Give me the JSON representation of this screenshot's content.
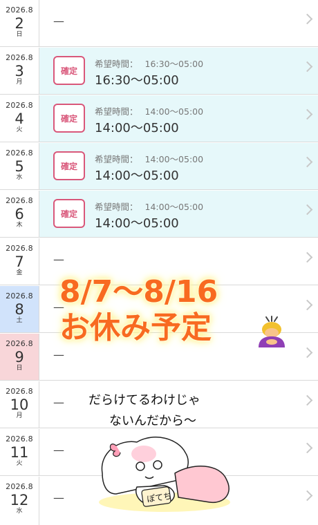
{
  "days": [
    {
      "ym": "2026.8",
      "day": "2",
      "weekday": "日",
      "confirmed": false,
      "dash": "—"
    },
    {
      "ym": "2026.8",
      "day": "3",
      "weekday": "月",
      "confirmed": true,
      "badge": "確定",
      "request_label": "希望時間：",
      "request_time": "16:30〜05:00",
      "time": "16:30〜05:00"
    },
    {
      "ym": "2026.8",
      "day": "4",
      "weekday": "火",
      "confirmed": true,
      "badge": "確定",
      "request_label": "希望時間：",
      "request_time": "14:00〜05:00",
      "time": "14:00〜05:00"
    },
    {
      "ym": "2026.8",
      "day": "5",
      "weekday": "水",
      "confirmed": true,
      "badge": "確定",
      "request_label": "希望時間：",
      "request_time": "14:00〜05:00",
      "time": "14:00〜05:00"
    },
    {
      "ym": "2026.8",
      "day": "6",
      "weekday": "木",
      "confirmed": true,
      "badge": "確定",
      "request_label": "希望時間：",
      "request_time": "14:00〜05:00",
      "time": "14:00〜05:00"
    },
    {
      "ym": "2026.8",
      "day": "7",
      "weekday": "金",
      "confirmed": false,
      "dash": "—"
    },
    {
      "ym": "2026.8",
      "day": "8",
      "weekday": "土",
      "confirmed": false,
      "dash": "—"
    },
    {
      "ym": "2026.8",
      "day": "9",
      "weekday": "日",
      "confirmed": false,
      "dash": "—"
    },
    {
      "ym": "2026.8",
      "day": "10",
      "weekday": "月",
      "confirmed": false,
      "dash": "—"
    },
    {
      "ym": "2026.8",
      "day": "11",
      "weekday": "火",
      "confirmed": false,
      "dash": "—"
    },
    {
      "ym": "2026.8",
      "day": "12",
      "weekday": "水",
      "confirmed": false,
      "dash": "—"
    }
  ],
  "overlay": {
    "line1": "8/7〜8/16",
    "line2": "お休み予定",
    "emoji": "person-bowing-emoji"
  },
  "handwriting": {
    "line1": "だらけてるわけじゃ",
    "line2": "ないんだから〜",
    "tag": "ぽてち"
  },
  "colors": {
    "confirmed_bg": "#e6f8fa",
    "badge": "#d9577a",
    "saturday": "#d1e3fb",
    "sunday": "#f8d6d9",
    "overlay_text": "#f86a20"
  }
}
